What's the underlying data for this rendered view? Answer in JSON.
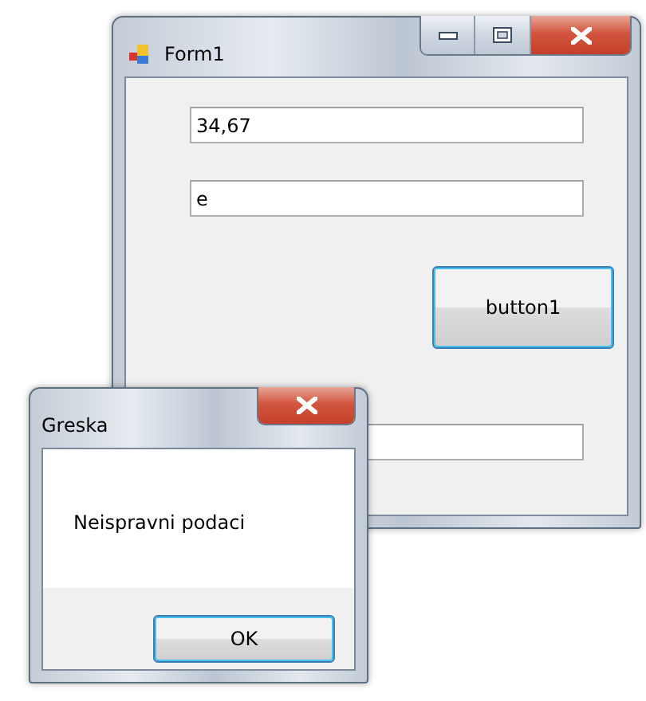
{
  "main_window": {
    "title": "Form1",
    "fields": [
      {
        "kind": "textbox",
        "value": "34,67"
      },
      {
        "kind": "textbox",
        "value": "e"
      },
      {
        "kind": "textbox"
      }
    ],
    "button": {
      "label": "button1"
    }
  },
  "dialog": {
    "title": "Greska",
    "message": "Neispravni podaci",
    "buttons": [
      "OK"
    ]
  }
}
